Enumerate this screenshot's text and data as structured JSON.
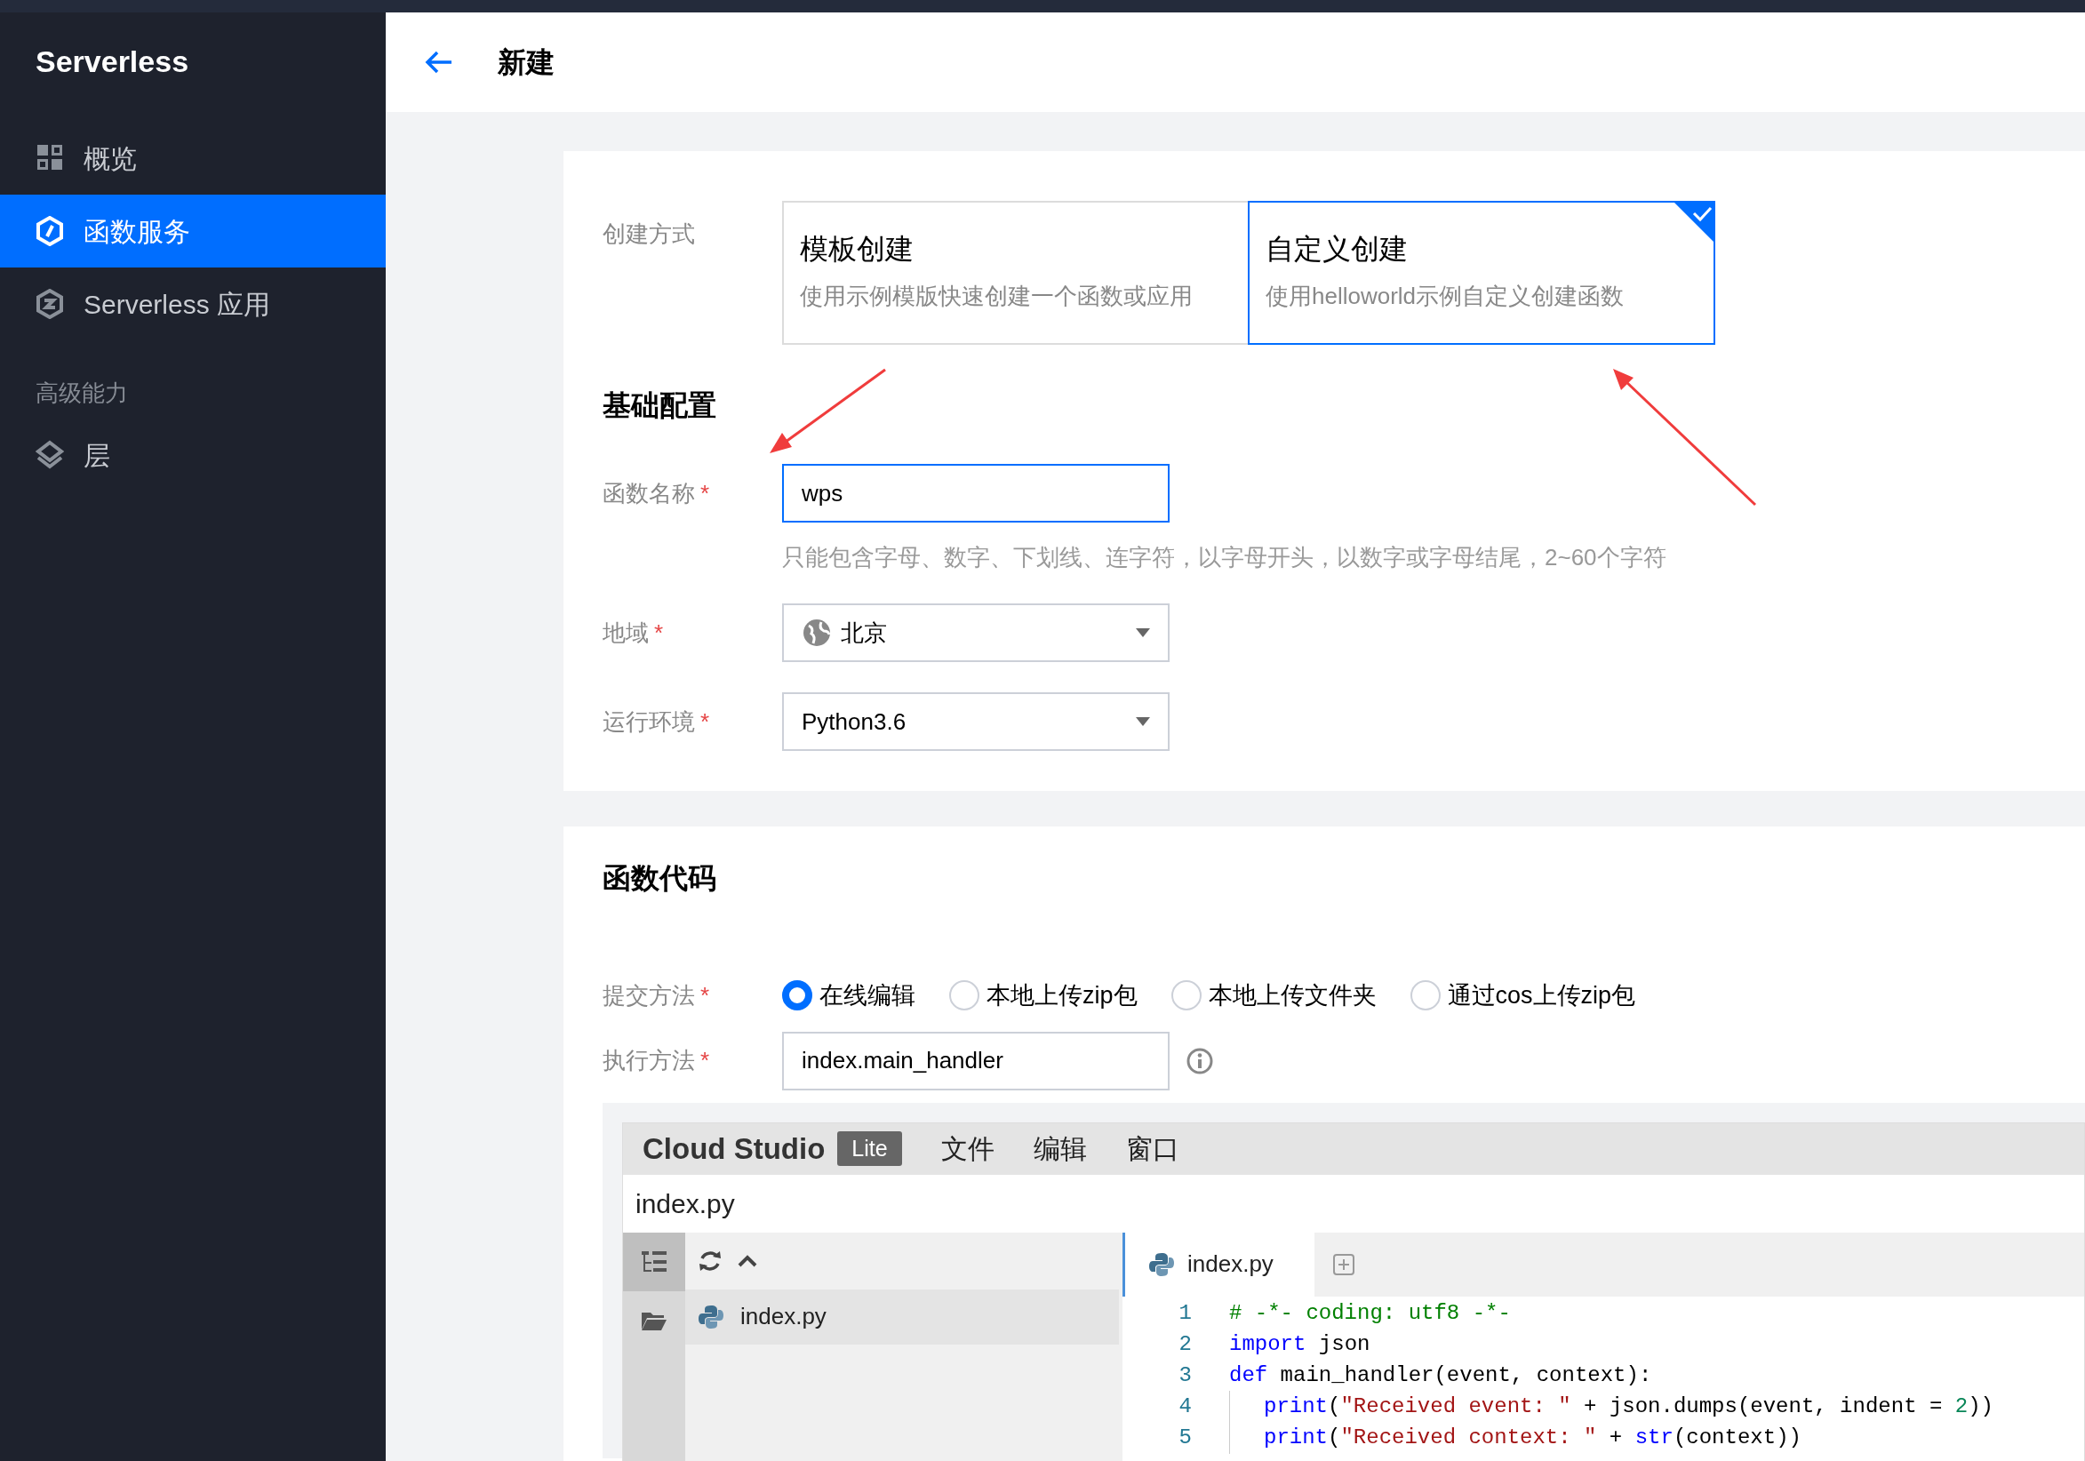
{
  "sidebar": {
    "title": "Serverless",
    "sections": [
      {
        "items": [
          {
            "label": "概览",
            "selected": false
          },
          {
            "label": "函数服务",
            "selected": true
          },
          {
            "label": "Serverless 应用",
            "selected": false
          }
        ]
      },
      {
        "heading": "高级能力",
        "items": [
          {
            "label": "层",
            "selected": false
          }
        ]
      }
    ]
  },
  "header": {
    "title": "新建"
  },
  "basic": {
    "create_method": {
      "label": "创建方式",
      "options": [
        {
          "title": "模板创建",
          "description": "使用示例模版快速创建一个函数或应用",
          "selected": false
        },
        {
          "title": "自定义创建",
          "description": "使用helloworld示例自定义创建函数",
          "selected": true
        }
      ]
    },
    "section_title": "基础配置",
    "fields": [
      {
        "kind": "text",
        "label": "函数名称",
        "required_mark": "*",
        "value": "wps",
        "focused": true,
        "hint": "只能包含字母、数字、下划线、连字符，以字母开头，以数字或字母结尾，2~60个字符"
      },
      {
        "kind": "select",
        "label": "地域",
        "required_mark": "*",
        "value": "北京",
        "globe": true
      },
      {
        "kind": "select",
        "label": "运行环境",
        "required_mark": "*",
        "value": "Python3.6",
        "globe": false
      }
    ]
  },
  "code": {
    "section_title": "函数代码",
    "submit": {
      "label": "提交方法",
      "required_mark": "*",
      "options": [
        {
          "label": "在线编辑",
          "selected": true
        },
        {
          "label": "本地上传zip包",
          "selected": false
        },
        {
          "label": "本地上传文件夹",
          "selected": false
        },
        {
          "label": "通过cos上传zip包",
          "selected": false
        }
      ]
    },
    "handler": {
      "label": "执行方法",
      "required_mark": "*",
      "value": "index.main_handler"
    },
    "editor": {
      "brand": "Cloud Studio",
      "badge": "Lite",
      "menu": [
        "文件",
        "编辑",
        "窗口"
      ],
      "title": "index.py",
      "files": [
        {
          "name": "index.py",
          "selected": true
        }
      ],
      "tabs": [
        {
          "label": "index.py",
          "selected": true
        }
      ],
      "lines": [
        {
          "number": "1",
          "indented": false,
          "tokens": [
            {
              "kind": "comment",
              "text": "# -*- coding: utf8 -*-"
            }
          ]
        },
        {
          "number": "2",
          "indented": false,
          "tokens": [
            {
              "kind": "keyword",
              "text": "import"
            },
            {
              "kind": "plain",
              "text": " json"
            }
          ]
        },
        {
          "number": "3",
          "indented": false,
          "tokens": [
            {
              "kind": "keyword",
              "text": "def"
            },
            {
              "kind": "plain",
              "text": " main_handler(event, context):"
            }
          ]
        },
        {
          "number": "4",
          "indented": true,
          "tokens": [
            {
              "kind": "keyword",
              "text": "print"
            },
            {
              "kind": "plain",
              "text": "("
            },
            {
              "kind": "string",
              "text": "\"Received event: \""
            },
            {
              "kind": "plain",
              "text": " + json.dumps(event, indent = "
            },
            {
              "kind": "number",
              "text": "2"
            },
            {
              "kind": "plain",
              "text": "))"
            }
          ]
        },
        {
          "number": "5",
          "indented": true,
          "tokens": [
            {
              "kind": "keyword",
              "text": "print"
            },
            {
              "kind": "plain",
              "text": "("
            },
            {
              "kind": "string",
              "text": "\"Received context: \""
            },
            {
              "kind": "plain",
              "text": " + "
            },
            {
              "kind": "keyword",
              "text": "str"
            },
            {
              "kind": "plain",
              "text": "(context))"
            }
          ]
        }
      ]
    }
  }
}
